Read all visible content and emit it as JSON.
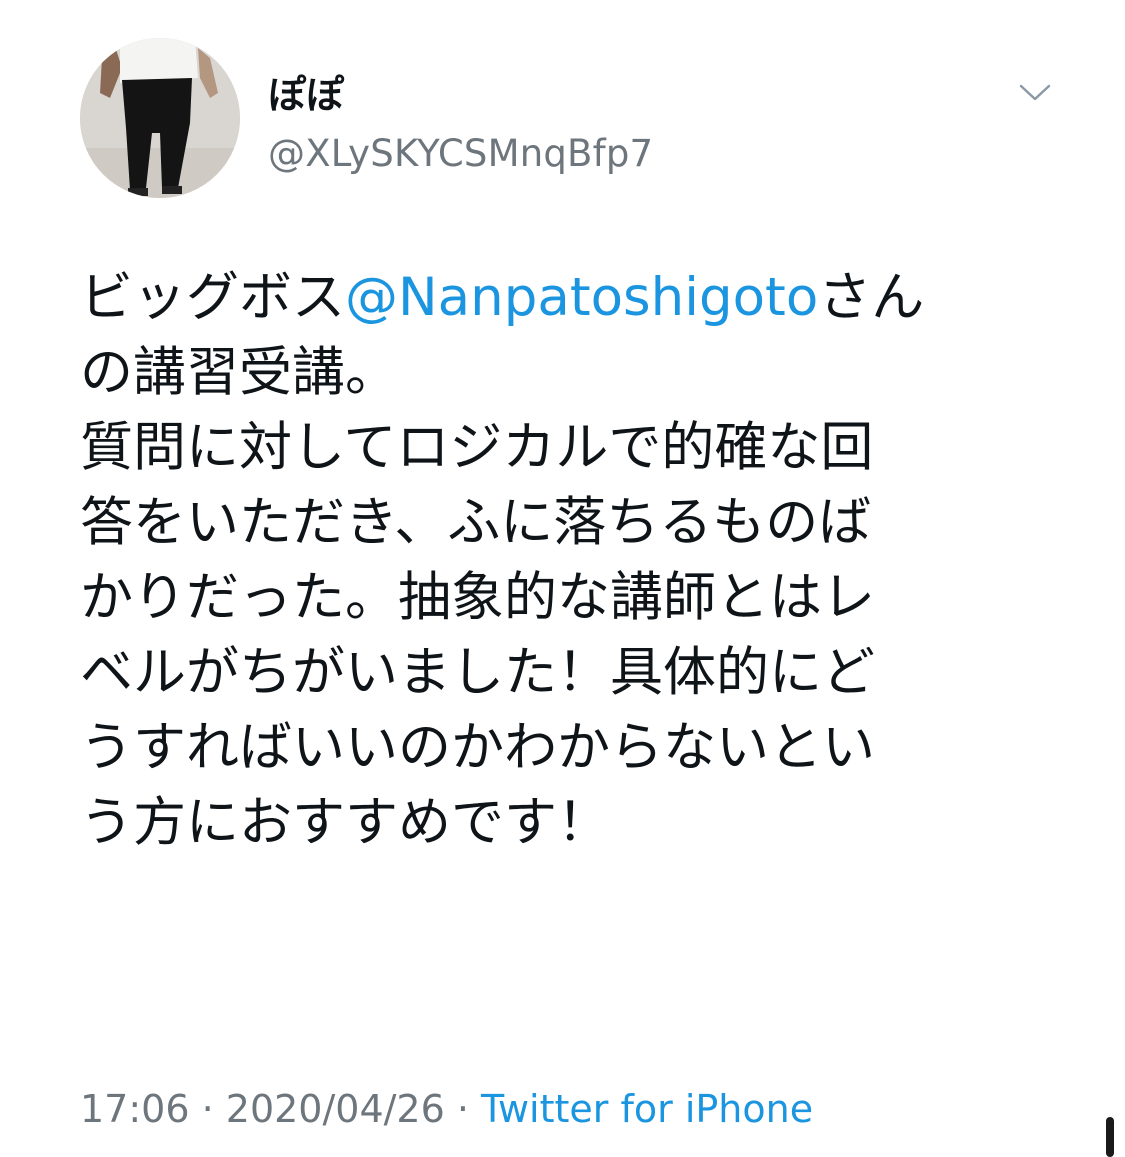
{
  "tweet": {
    "author": {
      "display_name": "ぽぽ",
      "handle": "@XLySKYCSMnqBfp7",
      "avatar_icon": "user-avatar"
    },
    "menu_icon": "chevron-down-icon",
    "body": {
      "line1_pre": "ビッグボス",
      "line1_mention": "@Nanpatoshigoto",
      "line1_post": "さん",
      "line2": "の講習受講。",
      "line3": "質問に対してロジカルで的確な回",
      "line4": "答をいただき、ふに落ちるものば",
      "line5": "かりだった。抽象的な講師とはレ",
      "line6": "ベルがちがいました！具体的にど",
      "line7": "うすればいいのかわからないとい",
      "line8": "う方におすすめです！"
    },
    "meta": {
      "time": "17:06",
      "separator": " · ",
      "date": "2020/04/26",
      "source": "Twitter for iPhone"
    }
  },
  "colors": {
    "text": "#0f1419",
    "secondary": "#6e767d",
    "link": "#1b95e0"
  }
}
